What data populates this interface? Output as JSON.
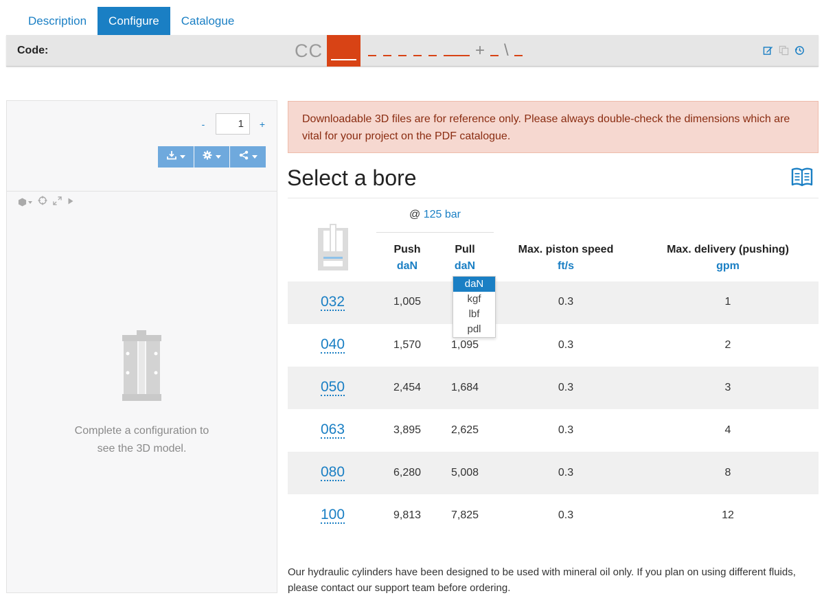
{
  "tabs": [
    {
      "label": "Description",
      "active": false
    },
    {
      "label": "Configure",
      "active": true
    },
    {
      "label": "Catalogue",
      "active": false
    }
  ],
  "codebar": {
    "label": "Code:",
    "prefix": "CC",
    "plus": "+",
    "backslash": "\\",
    "actions": [
      "edit-icon",
      "copy-icon",
      "history-icon"
    ]
  },
  "left_panel": {
    "qty_minus": "-",
    "qty_value": "1",
    "qty_plus": "+",
    "buttons": [
      "download-icon",
      "gear-icon",
      "share-icon"
    ],
    "viewer_tools": [
      "cube-icon",
      "target-icon",
      "expand-icon",
      "play-icon"
    ],
    "placeholder_line1": "Complete a configuration to",
    "placeholder_line2": "see the 3D model."
  },
  "alert": {
    "text": "Downloadable 3D files are for reference only. Please always double-check the dimensions which are vital for your project on the PDF catalogue."
  },
  "heading": "Select a bore",
  "table": {
    "pressure_prefix": "@",
    "pressure_value": "125 bar",
    "columns": [
      {
        "label": "Push",
        "unit": "daN"
      },
      {
        "label": "Pull",
        "unit": "daN"
      },
      {
        "label": "Max. piston speed",
        "unit": "ft/s"
      },
      {
        "label": "Max. delivery (pushing)",
        "unit": "gpm"
      }
    ],
    "rows": [
      {
        "bore": "032",
        "push": "1,005",
        "pull": "",
        "speed": "0.3",
        "delivery": "1"
      },
      {
        "bore": "040",
        "push": "1,570",
        "pull": "1,095",
        "speed": "0.3",
        "delivery": "2"
      },
      {
        "bore": "050",
        "push": "2,454",
        "pull": "1,684",
        "speed": "0.3",
        "delivery": "3"
      },
      {
        "bore": "063",
        "push": "3,895",
        "pull": "2,625",
        "speed": "0.3",
        "delivery": "4"
      },
      {
        "bore": "080",
        "push": "6,280",
        "pull": "5,008",
        "speed": "0.3",
        "delivery": "8"
      },
      {
        "bore": "100",
        "push": "9,813",
        "pull": "7,825",
        "speed": "0.3",
        "delivery": "12"
      }
    ]
  },
  "unit_dropdown": {
    "options": [
      "daN",
      "kgf",
      "lbf",
      "pdl"
    ],
    "selected": "daN"
  },
  "footer": {
    "line1": "Our hydraulic cylinders have been designed to be used with mineral oil only. If you plan on using different fluids,",
    "line2": "please contact our support team before ordering."
  },
  "colors": {
    "accent": "#1a7fc4",
    "code_highlight": "#d84315",
    "alert_bg": "#f6d8d0",
    "button_blue": "#6fa9dd"
  }
}
